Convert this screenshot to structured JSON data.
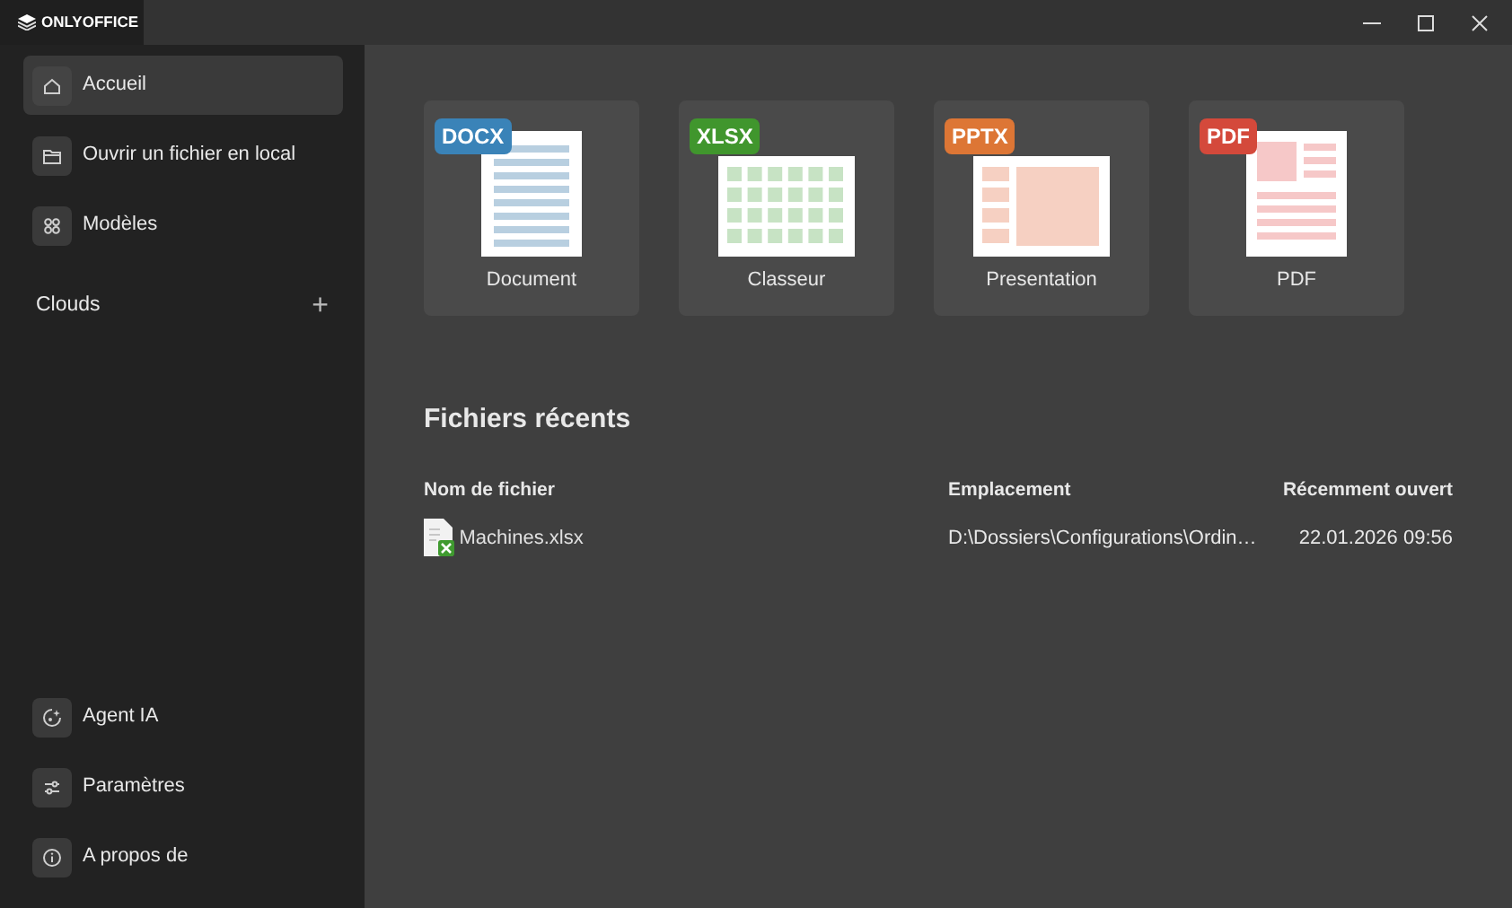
{
  "window": {
    "tab_title": "ONLYOFFICE"
  },
  "sidebar": {
    "items": [
      {
        "label": "Accueil",
        "selected": true
      },
      {
        "label": "Ouvrir un fichier en local",
        "selected": false
      },
      {
        "label": "Modèles",
        "selected": false
      }
    ],
    "clouds": {
      "label": "Clouds",
      "add": "+"
    },
    "bottom_items": [
      {
        "label": "Agent IA",
        "selected": false
      },
      {
        "label": "Paramètres",
        "selected": false
      },
      {
        "label": "A propos de",
        "selected": false
      }
    ]
  },
  "create": [
    {
      "kind": "docx",
      "badge": "DOCX",
      "color": "#3a83b8",
      "label": "Document"
    },
    {
      "kind": "xlsx",
      "badge": "XLSX",
      "color": "#40962d",
      "label": "Classeur"
    },
    {
      "kind": "pptx",
      "badge": "PPTX",
      "color": "#dd7635",
      "label": "Presentation"
    },
    {
      "kind": "pdf",
      "badge": "PDF",
      "color": "#d4493b",
      "label": "PDF"
    }
  ],
  "recent": {
    "title": "Fichiers récents",
    "columns": [
      "Nom de fichier",
      "Emplacement",
      "Récemment ouvert"
    ],
    "rows": [
      {
        "name": "Machines.xlsx",
        "location": "D:\\Dossiers\\Configurations\\Ordin…",
        "opened": "22.01.2026 09:56"
      }
    ]
  }
}
